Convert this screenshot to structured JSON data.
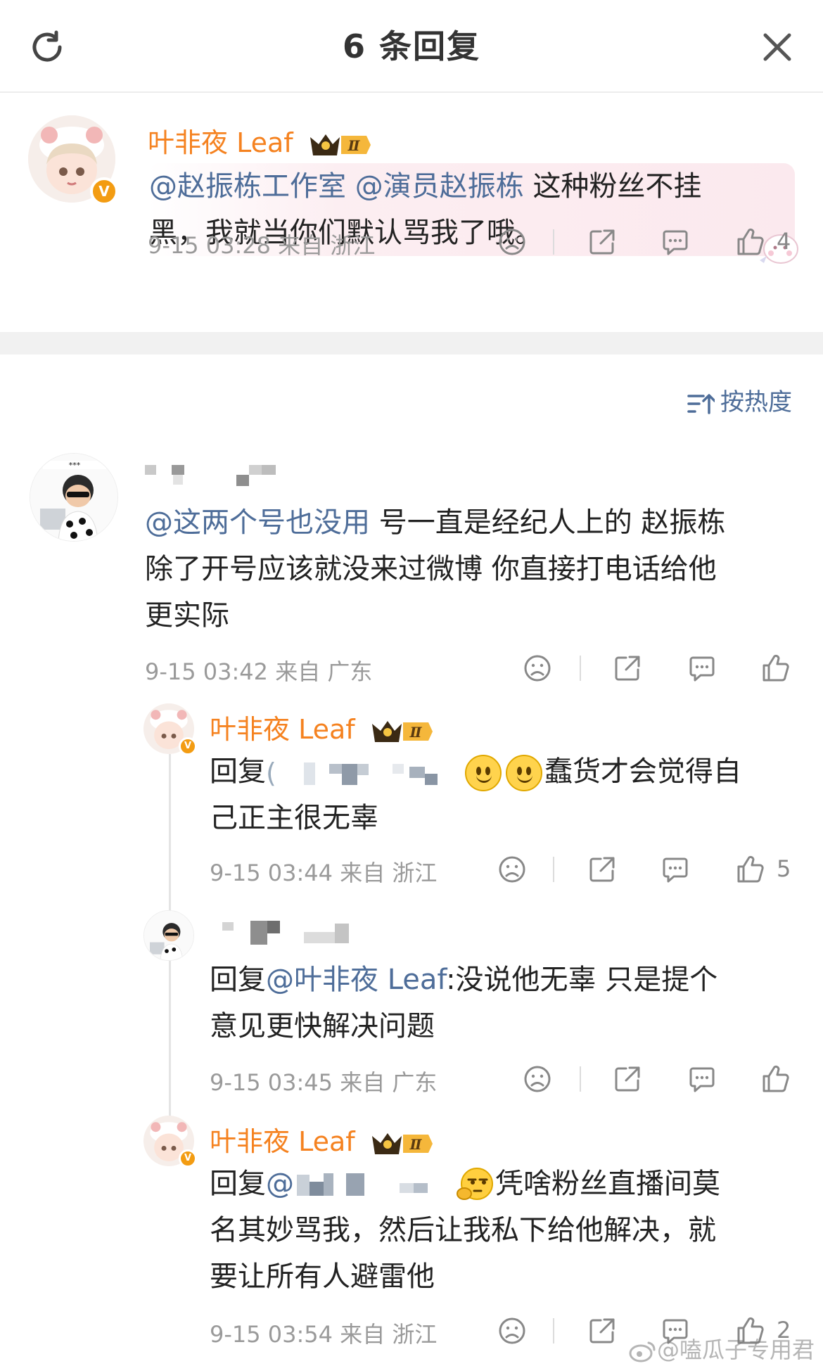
{
  "header": {
    "title": "6 条回复"
  },
  "root": {
    "name": "叶非夜 Leaf",
    "badge": "Ⅱ",
    "mentions": [
      "@赵振栋工作室",
      "@演员赵振栋"
    ],
    "text_line1": "这种粉丝不挂",
    "text_line2": "黑，我就当你们默认骂我了哦。",
    "meta": "9-15 03:28 来自 浙江",
    "likes": "4"
  },
  "sort": {
    "label": "按热度"
  },
  "comment1": {
    "mention": "@这两个号也没用",
    "text_line1": "号一直是经纪人上的 赵振栋",
    "text_line2": "除了开号应该就没来过微博  你直接打电话给他",
    "text_line3": "更实际",
    "meta": "9-15 03:42 来自 广东"
  },
  "reply1": {
    "name": "叶非夜 Leaf",
    "badge": "Ⅱ",
    "prefix": "回复",
    "text_line1": "蠢货才会觉得自",
    "text_line2": "己正主很无辜",
    "meta": "9-15 03:44 来自 浙江",
    "likes": "5"
  },
  "reply2": {
    "prefix": "回复",
    "mention": "@叶非夜 Leaf",
    "text_line1": ":没说他无辜 只是提个",
    "text_line2": "意见更快解决问题",
    "meta": "9-15 03:45 来自 广东"
  },
  "reply3": {
    "name": "叶非夜 Leaf",
    "badge": "Ⅱ",
    "prefix": "回复",
    "mention": "@",
    "text_line1": "凭啥粉丝直播间莫",
    "text_line2": "名其妙骂我，然后让我私下给他解决，就",
    "text_line3": "要让所有人避雷他",
    "meta": "9-15 03:54 来自 浙江",
    "likes": "2"
  },
  "watermark": "@嗑瓜子专用君",
  "colors": {
    "name": "#f58220",
    "mention": "#4e6d99",
    "meta": "#9a9a9a"
  }
}
